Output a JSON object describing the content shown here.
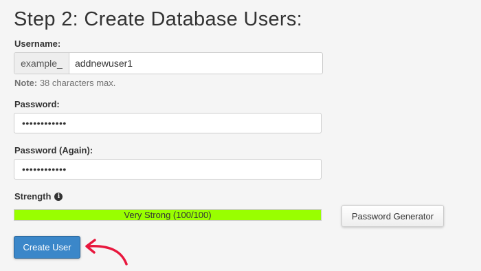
{
  "title": "Step 2: Create Database Users:",
  "username": {
    "label": "Username:",
    "prefix": "example_",
    "value": "addnewuser1",
    "note_label": "Note:",
    "note_text": " 38 characters max."
  },
  "password": {
    "label": "Password:",
    "value": "••••••••••••"
  },
  "password_again": {
    "label": "Password (Again):",
    "value": "••••••••••••"
  },
  "strength": {
    "label": "Strength",
    "icon": "info-icon",
    "text": "Very Strong (100/100)",
    "percent": 100,
    "color": "#99ff00"
  },
  "buttons": {
    "password_generator": "Password Generator",
    "create_user": "Create User"
  },
  "colors": {
    "primary_button": "#3b87c9",
    "annotation_arrow": "#e8173d"
  }
}
